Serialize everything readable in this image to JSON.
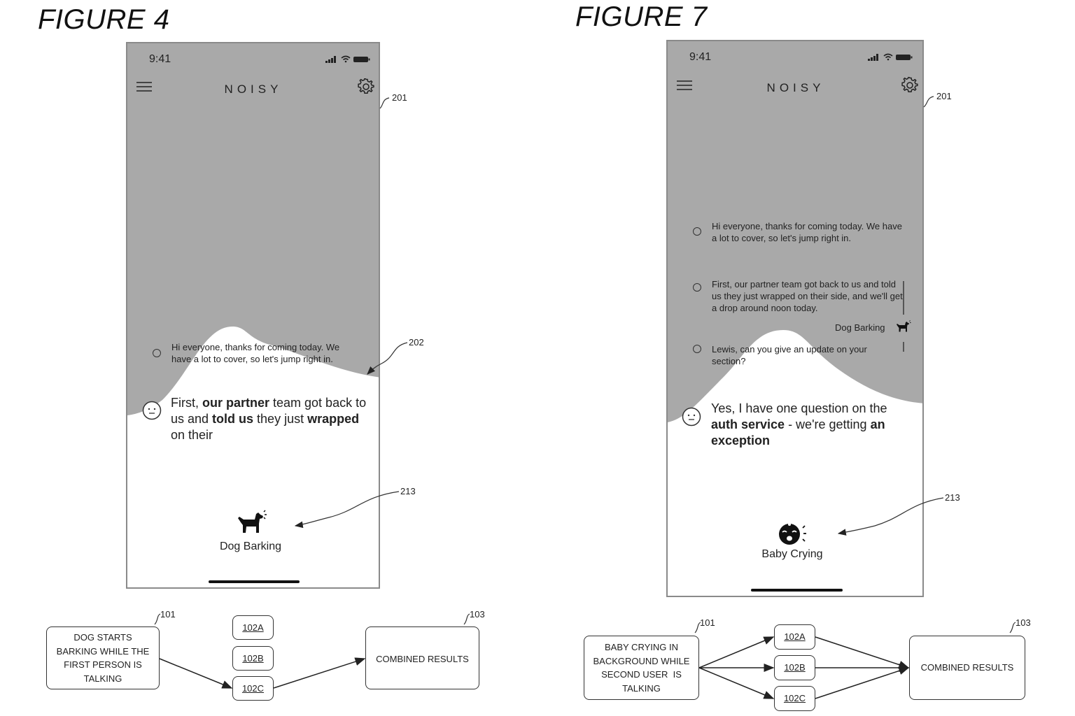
{
  "figures": [
    {
      "title": "FIGURE 4",
      "phone": {
        "status_time": "9:41",
        "app_title": "NOISY",
        "menu_icon": "hamburger-menu-icon",
        "settings_icon": "gear-icon",
        "messages": [
          {
            "text": "Hi everyone, thanks for coming today. We have a lot to cover, so let's jump right in.",
            "style": "small"
          }
        ],
        "active_message": {
          "segments": [
            {
              "text": "First, ",
              "bold": false
            },
            {
              "text": "our partner",
              "bold": true
            },
            {
              "text": " team got back to us and ",
              "bold": false
            },
            {
              "text": "told us",
              "bold": true
            },
            {
              "text": " they just ",
              "bold": false
            },
            {
              "text": "wrapped",
              "bold": true
            },
            {
              "text": " on their",
              "bold": false
            }
          ]
        },
        "event": {
          "icon": "dog-barking-icon",
          "label": "Dog Barking"
        }
      },
      "refs": {
        "phone": "201",
        "wave": "202",
        "event": "213"
      },
      "flow": {
        "source": {
          "ref": "101",
          "lines": [
            "DOG STARTS",
            "BARKING WHILE THE",
            "FIRST PERSON IS",
            "TALKING"
          ]
        },
        "models": [
          "102A",
          "102B",
          "102C"
        ],
        "active_models": [
          "102C"
        ],
        "result": {
          "ref": "103",
          "label": "COMBINED RESULTS"
        }
      }
    },
    {
      "title": "FIGURE 7",
      "phone": {
        "status_time": "9:41",
        "app_title": "NOISY",
        "menu_icon": "hamburger-menu-icon",
        "settings_icon": "gear-icon",
        "messages": [
          {
            "text": "Hi everyone, thanks for coming today. We have a lot to cover, so let's jump right in.",
            "style": "small"
          },
          {
            "text": "First, our partner team got back to us and told us they just wrapped on their side, and we'll get a drop around noon today.",
            "style": "small"
          },
          {
            "text": "Lewis, can you give an update on your section?",
            "style": "small"
          }
        ],
        "inline_tag": {
          "label": "Dog Barking",
          "icon": "dog-barking-icon"
        },
        "active_message": {
          "segments": [
            {
              "text": "Yes, I have one question on the ",
              "bold": false
            },
            {
              "text": "auth service",
              "bold": true
            },
            {
              "text": " - we're getting ",
              "bold": false
            },
            {
              "text": "an exception",
              "bold": true
            }
          ]
        },
        "event": {
          "icon": "baby-crying-icon",
          "label": "Baby Crying"
        }
      },
      "refs": {
        "phone": "201",
        "event": "213"
      },
      "flow": {
        "source": {
          "ref": "101",
          "lines": [
            "BABY CRYING IN",
            "BACKGROUND WHILE",
            "SECOND USER  IS",
            "TALKING"
          ]
        },
        "models": [
          "102A",
          "102B",
          "102C"
        ],
        "active_models": [
          "102A",
          "102B",
          "102C"
        ],
        "result": {
          "ref": "103",
          "label": "COMBINED RESULTS"
        }
      }
    }
  ],
  "colors": {
    "shade": "#a9a9a9",
    "line": "#333333",
    "text": "#222222"
  }
}
